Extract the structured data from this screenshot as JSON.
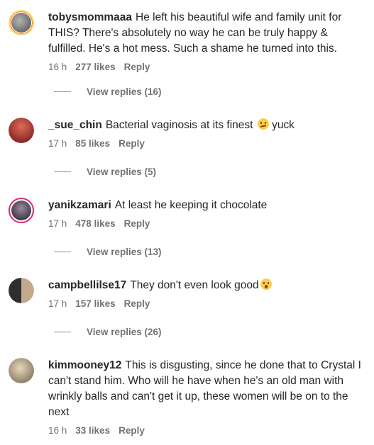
{
  "comments": [
    {
      "username": "tobysmommaaa",
      "text": "He left his beautiful wife and family unit for THIS? There's absolutely no way he can be truly happy & fulfilled. He's a hot mess. Such a shame he turned into this.",
      "time": "16 h",
      "likes": "277 likes",
      "reply": "Reply",
      "view_replies": "View replies (16)",
      "avatar_colors": [
        "#9a9a9a",
        "#5a5a5a"
      ]
    },
    {
      "username": "_sue_chin",
      "text": "Bacterial vaginosis at its finest",
      "text_after_emoji": "yuck",
      "emoji": "woozy-face-icon",
      "time": "17 h",
      "likes": "85 likes",
      "reply": "Reply",
      "view_replies": "View replies (5)",
      "avatar_colors": [
        "#c0392b",
        "#5b1010"
      ]
    },
    {
      "username": "yanikzamari",
      "text": "At least he keeping it chocolate",
      "time": "17 h",
      "likes": "478 likes",
      "reply": "Reply",
      "view_replies": "View replies (13)",
      "avatar_colors": [
        "#7a6a7f",
        "#2b2230"
      ]
    },
    {
      "username": "campbellilse17",
      "text": "They don't even look good",
      "emoji": "astonished-face-icon",
      "time": "17 h",
      "likes": "157 likes",
      "reply": "Reply",
      "view_replies": "View replies (26)",
      "avatar_colors": [
        "#3a3a3a",
        "#b8a08a"
      ]
    },
    {
      "username": "kimmooney12",
      "text": "This is disgusting, since he done that to Crystal I can't stand him. Who will he have when he's an old man with wrinkly balls and can't get it up, these women will be on to the next",
      "time": "16 h",
      "likes": "33 likes",
      "reply": "Reply",
      "avatar_colors": [
        "#d9c6a8",
        "#7a6a55"
      ]
    }
  ]
}
